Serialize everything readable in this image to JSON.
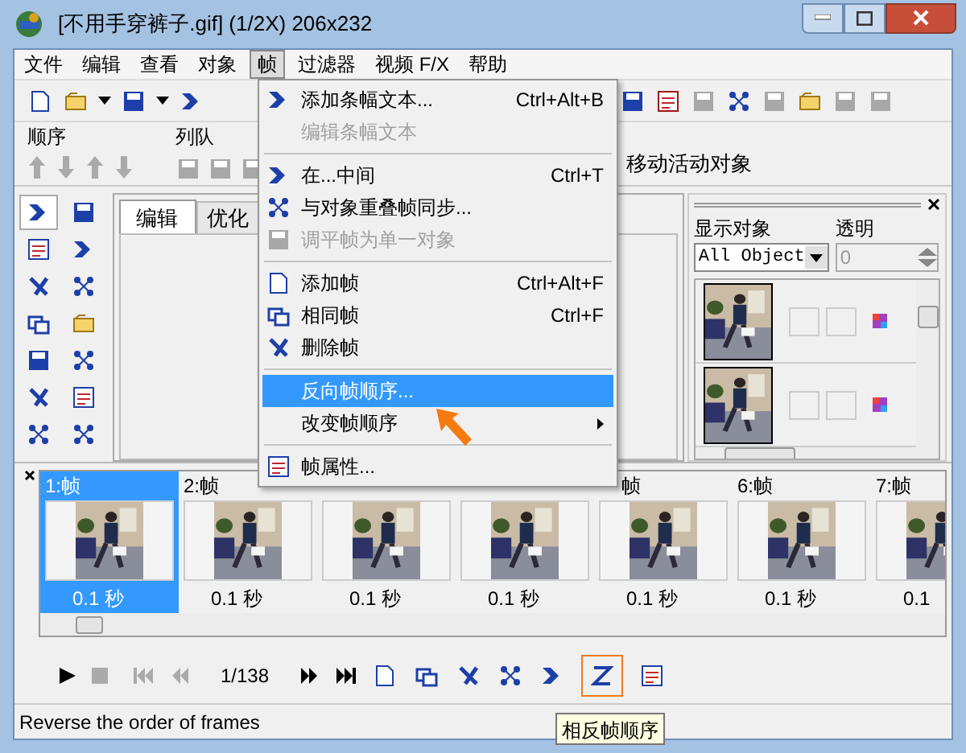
{
  "window": {
    "title": "[不用手穿裤子.gif] (1/2X)  206x232"
  },
  "menu_bar": [
    {
      "label": "文件",
      "selected": false
    },
    {
      "label": "编辑",
      "selected": false
    },
    {
      "label": "查看",
      "selected": false
    },
    {
      "label": "对象",
      "selected": false
    },
    {
      "label": "帧",
      "selected": true
    },
    {
      "label": "过滤器",
      "selected": false
    },
    {
      "label": "视频 F/X",
      "selected": false
    },
    {
      "label": "帮助",
      "selected": false
    }
  ],
  "order_label": "顺序",
  "queue_label": "列队",
  "move_label": "移动活动对象",
  "tools": [
    {
      "selected": true
    },
    {
      "selected": false
    },
    {
      "selected": false
    },
    {
      "selected": false
    },
    {
      "selected": false
    },
    {
      "selected": false
    },
    {
      "selected": false
    },
    {
      "selected": false
    },
    {
      "selected": false
    },
    {
      "selected": false
    },
    {
      "selected": false
    },
    {
      "selected": false
    },
    {
      "selected": false
    },
    {
      "selected": false
    }
  ],
  "tabs": [
    {
      "label": "编辑",
      "selected": true
    },
    {
      "label": "优化",
      "selected": false
    }
  ],
  "object_panel": {
    "show_label": "显示对象",
    "show_value": "All Object",
    "transparent_label": "透明",
    "transparent_value": "0"
  },
  "frames": [
    {
      "label": "1:帧",
      "duration": "0.1 秒",
      "selected": true
    },
    {
      "label": "2:帧",
      "duration": "0.1 秒",
      "selected": false
    },
    {
      "duration": "0.1 秒",
      "selected": false
    },
    {
      "duration": "0.1 秒",
      "selected": false
    },
    {
      "label": "帧",
      "duration": "0.1 秒",
      "selected": false
    },
    {
      "label": "6:帧",
      "duration": "0.1 秒",
      "selected": false
    },
    {
      "label": "7:帧",
      "duration": "0.1",
      "selected": false
    }
  ],
  "playback": {
    "counter": "1/138",
    "reverse_hovered": true
  },
  "status_bar": "Reverse the order of frames",
  "tooltip": "相反帧顺序",
  "frame_menu": [
    {
      "kind": "item",
      "label": "添加条幅文本...",
      "shortcut": "Ctrl+Alt+B",
      "disabled": false,
      "selected": false
    },
    {
      "kind": "item",
      "label": "编辑条幅文本",
      "disabled": true,
      "selected": false
    },
    {
      "kind": "separator"
    },
    {
      "kind": "item",
      "label": "在...中间",
      "shortcut": "Ctrl+T",
      "disabled": false,
      "selected": false
    },
    {
      "kind": "item",
      "label": "与对象重叠帧同步...",
      "disabled": false,
      "selected": false
    },
    {
      "kind": "item",
      "label": "调平帧为单一对象",
      "disabled": true,
      "selected": false
    },
    {
      "kind": "separator"
    },
    {
      "kind": "item",
      "label": "添加帧",
      "shortcut": "Ctrl+Alt+F",
      "disabled": false,
      "selected": false
    },
    {
      "kind": "item",
      "label": "相同帧",
      "shortcut": "Ctrl+F",
      "disabled": false,
      "selected": false
    },
    {
      "kind": "item",
      "label": "删除帧",
      "disabled": false,
      "selected": false
    },
    {
      "kind": "separator"
    },
    {
      "kind": "item",
      "label": "反向帧顺序...",
      "disabled": false,
      "selected": true
    },
    {
      "kind": "item",
      "label": "改变帧顺序",
      "disabled": false,
      "selected": false,
      "submenu": true
    },
    {
      "kind": "separator"
    },
    {
      "kind": "item",
      "label": "帧属性...",
      "disabled": false,
      "selected": false
    }
  ]
}
